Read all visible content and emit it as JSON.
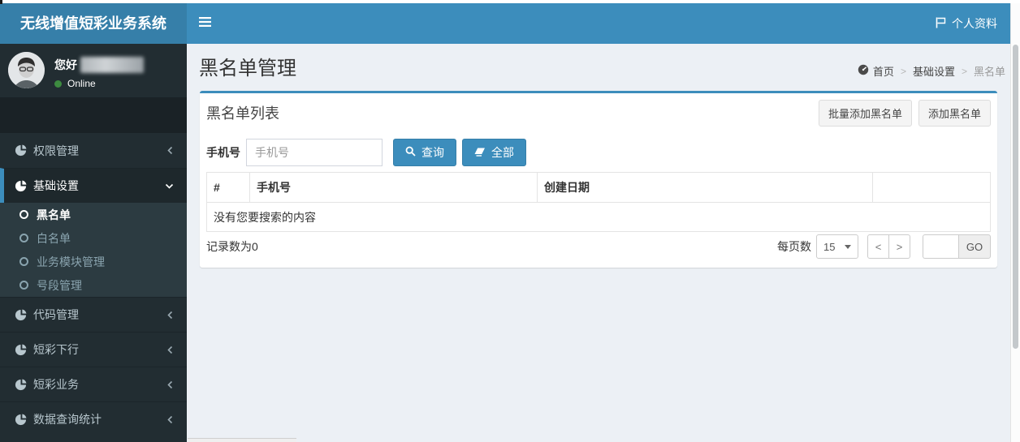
{
  "app_title": "无线增值短彩业务系统",
  "navbar": {
    "profile_label": "个人资料"
  },
  "user_panel": {
    "greeting": "您好",
    "status_label": "Online"
  },
  "sidebar": {
    "items": [
      {
        "label": "权限管理"
      },
      {
        "label": "基础设置",
        "children": [
          {
            "label": "黑名单"
          },
          {
            "label": "白名单"
          },
          {
            "label": "业务模块管理"
          },
          {
            "label": "号段管理"
          }
        ]
      },
      {
        "label": "代码管理"
      },
      {
        "label": "短彩下行"
      },
      {
        "label": "短彩业务"
      },
      {
        "label": "数据查询统计"
      }
    ]
  },
  "page": {
    "title": "黑名单管理",
    "breadcrumb": {
      "home": "首页",
      "section": "基础设置",
      "current": "黑名单"
    }
  },
  "box": {
    "title": "黑名单列表",
    "buttons": {
      "batch_add": "批量添加黑名单",
      "add": "添加黑名单"
    },
    "search": {
      "label": "手机号",
      "placeholder": "手机号",
      "query": "查询",
      "all": "全部"
    },
    "table": {
      "headers": [
        "#",
        "手机号",
        "创建日期",
        ""
      ],
      "empty_text": "没有您要搜索的内容"
    },
    "footer": {
      "record_count": "记录数为0",
      "per_page_label": "每页数",
      "per_page_value": "15",
      "prev": "<",
      "next": ">",
      "go": "GO"
    }
  },
  "colors": {
    "navbar": "#3c8dbc",
    "logo_bg": "#367fa9",
    "sidebar_bg": "#222d32",
    "submenu_bg": "#2c3b41",
    "content_bg": "#ecf0f5",
    "primary": "#3c8dbc",
    "online_dot": "#3d8b40"
  }
}
